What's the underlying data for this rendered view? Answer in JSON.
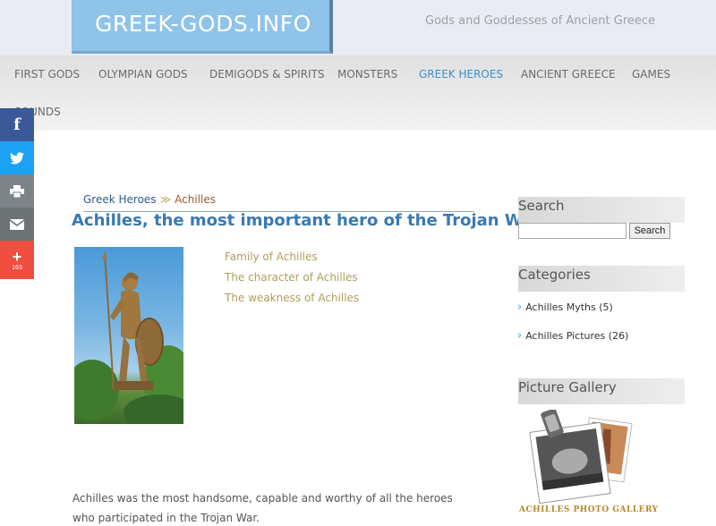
{
  "site": {
    "logo": "GREEK-GODS.INFO",
    "tagline": "Gods and Goddesses of Ancient Greece"
  },
  "nav": {
    "items": [
      {
        "label": "FIRST GODS",
        "active": false
      },
      {
        "label": "OLYMPIAN GODS",
        "active": false
      },
      {
        "label": "DEMIGODS & SPIRITS",
        "active": false
      },
      {
        "label": "MONSTERS",
        "active": false
      },
      {
        "label": "GREEK HEROES",
        "active": true
      },
      {
        "label": "ANCIENT GREECE",
        "active": false
      },
      {
        "label": "GAMES",
        "active": false
      },
      {
        "label": "SOUNDS",
        "active": false
      }
    ]
  },
  "social": {
    "share_count": "163",
    "buttons": [
      "facebook-icon",
      "twitter-icon",
      "print-icon",
      "email-icon",
      "plus-icon"
    ]
  },
  "breadcrumb": {
    "parent": "Greek Heroes",
    "separator": "≫",
    "current": "Achilles"
  },
  "page": {
    "title": "Achilles, the most important hero of the Trojan War",
    "toc": [
      "Family of Achilles",
      "The character of Achilles",
      "The weakness of Achilles"
    ],
    "intro": "Achilles was the most handsome, capable and worthy of all the heroes who participated in the Trojan War."
  },
  "sidebar": {
    "search_title": "Search",
    "search_button": "Search",
    "search_value": "",
    "categories_title": "Categories",
    "categories": [
      {
        "label": "Achilles Myths (5)"
      },
      {
        "label": "Achilles Pictures (26)"
      }
    ],
    "gallery_title": "Picture Gallery",
    "gallery_caption": "ACHILLES PHOTO GALLERY"
  },
  "colors": {
    "logo_bg": "#8fc3ea",
    "active_nav": "#3d8fc7",
    "title": "#3a79b3",
    "toc_link": "#b09d5c"
  }
}
